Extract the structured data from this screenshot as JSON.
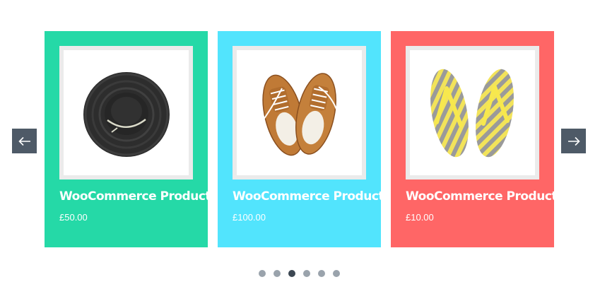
{
  "carousel": {
    "prev_icon": "arrow-left-icon",
    "next_icon": "arrow-right-icon",
    "products": [
      {
        "title": "WooCommerce Product",
        "price": "£50.00",
        "bg": "#25d9a7",
        "image": "black-sun-hat"
      },
      {
        "title": "WooCommerce Product",
        "price": "£100.00",
        "bg": "#52e4fd",
        "image": "brown-leather-sneakers"
      },
      {
        "title": "WooCommerce Product",
        "price": "£10.00",
        "bg": "#ff6666",
        "image": "yellow-grey-striped-flip-flops"
      }
    ],
    "pagination": {
      "count": 6,
      "active_index": 2
    }
  },
  "colors": {
    "arrow_bg": "#4e5a67",
    "dot": "#9aa3ac",
    "dot_active": "#3c4752"
  }
}
